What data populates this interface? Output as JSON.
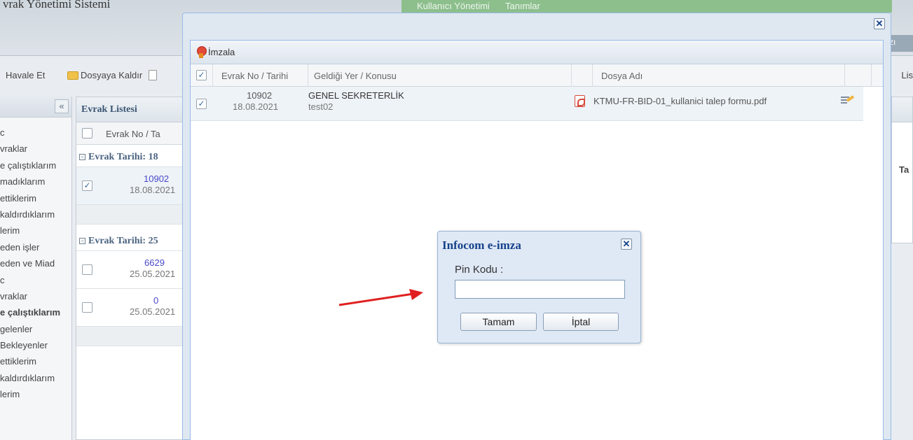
{
  "app": {
    "title": "vrak Yönetimi Sistemi",
    "top_menu": [
      "Kullanıcı Yönetimi",
      "Tanımlar"
    ],
    "header_right": "zı"
  },
  "toolbar": {
    "havale_label": "Havale Et",
    "dosyaya_kaldir_label": "Dosyaya Kaldır",
    "right_label": "Lis"
  },
  "sidebar": {
    "collapse_symbol": "«",
    "items": [
      {
        "label": "c",
        "bold": false
      },
      {
        "label": "vraklar",
        "bold": false
      },
      {
        "label": "e çalıştıklarım",
        "bold": false
      },
      {
        "label": "madıklarım",
        "bold": false
      },
      {
        "label": "ettiklerim",
        "bold": false
      },
      {
        "label": "kaldırdıklarım",
        "bold": false
      },
      {
        "label": "lerim",
        "bold": false
      },
      {
        "label": "eden işler",
        "bold": false
      },
      {
        "label": "eden ve Miad",
        "bold": false
      },
      {
        "label": "c",
        "bold": false
      },
      {
        "label": "vraklar",
        "bold": false
      },
      {
        "label": "e çalıştıklarım",
        "bold": true
      },
      {
        "label": "gelenler",
        "bold": false
      },
      {
        "label": "Bekleyenler",
        "bold": false
      },
      {
        "label": "ettiklerim",
        "bold": false
      },
      {
        "label": "kaldırdıklarım",
        "bold": false
      },
      {
        "label": "lerim",
        "bold": false
      }
    ]
  },
  "evrak_listesi": {
    "title": "Evrak Listesi",
    "column": "Evrak No / Ta",
    "groups": [
      {
        "header": "Evrak Tarihi: 18",
        "rows": [
          {
            "no": "10902",
            "date": "18.08.2021",
            "checked": true
          }
        ]
      },
      {
        "header": "Evrak Tarihi: 25",
        "rows": [
          {
            "no": "6629",
            "date": "25.05.2021",
            "checked": false
          },
          {
            "no": "0",
            "date": "25.05.2021",
            "checked": false
          }
        ]
      }
    ]
  },
  "right_panel": {
    "header": "Ta"
  },
  "modal": {
    "close_symbol": "✕",
    "sign_label": "İmzala",
    "columns": {
      "no_date": "Evrak No / Tarihi",
      "origin_subject": "Geldiği Yer / Konusu",
      "file_name": "Dosya Adı"
    },
    "rows": [
      {
        "checked": true,
        "no": "10902",
        "date": "18.08.2021",
        "origin": "GENEL SEKRETERLİK",
        "subject": "test02",
        "file_name": "KTMU-FR-BID-01_kullanici talep formu.pdf"
      }
    ]
  },
  "signing_dialog": {
    "title": "Infocom e-imza",
    "close_symbol": "✕",
    "pin_label": "Pin Kodu :",
    "pin_value": "",
    "ok_label": "Tamam",
    "cancel_label": "İptal"
  },
  "colors": {
    "accent_blue": "#15428b",
    "arrow_red": "#e02020",
    "menu_green": "#8dbf8d"
  }
}
